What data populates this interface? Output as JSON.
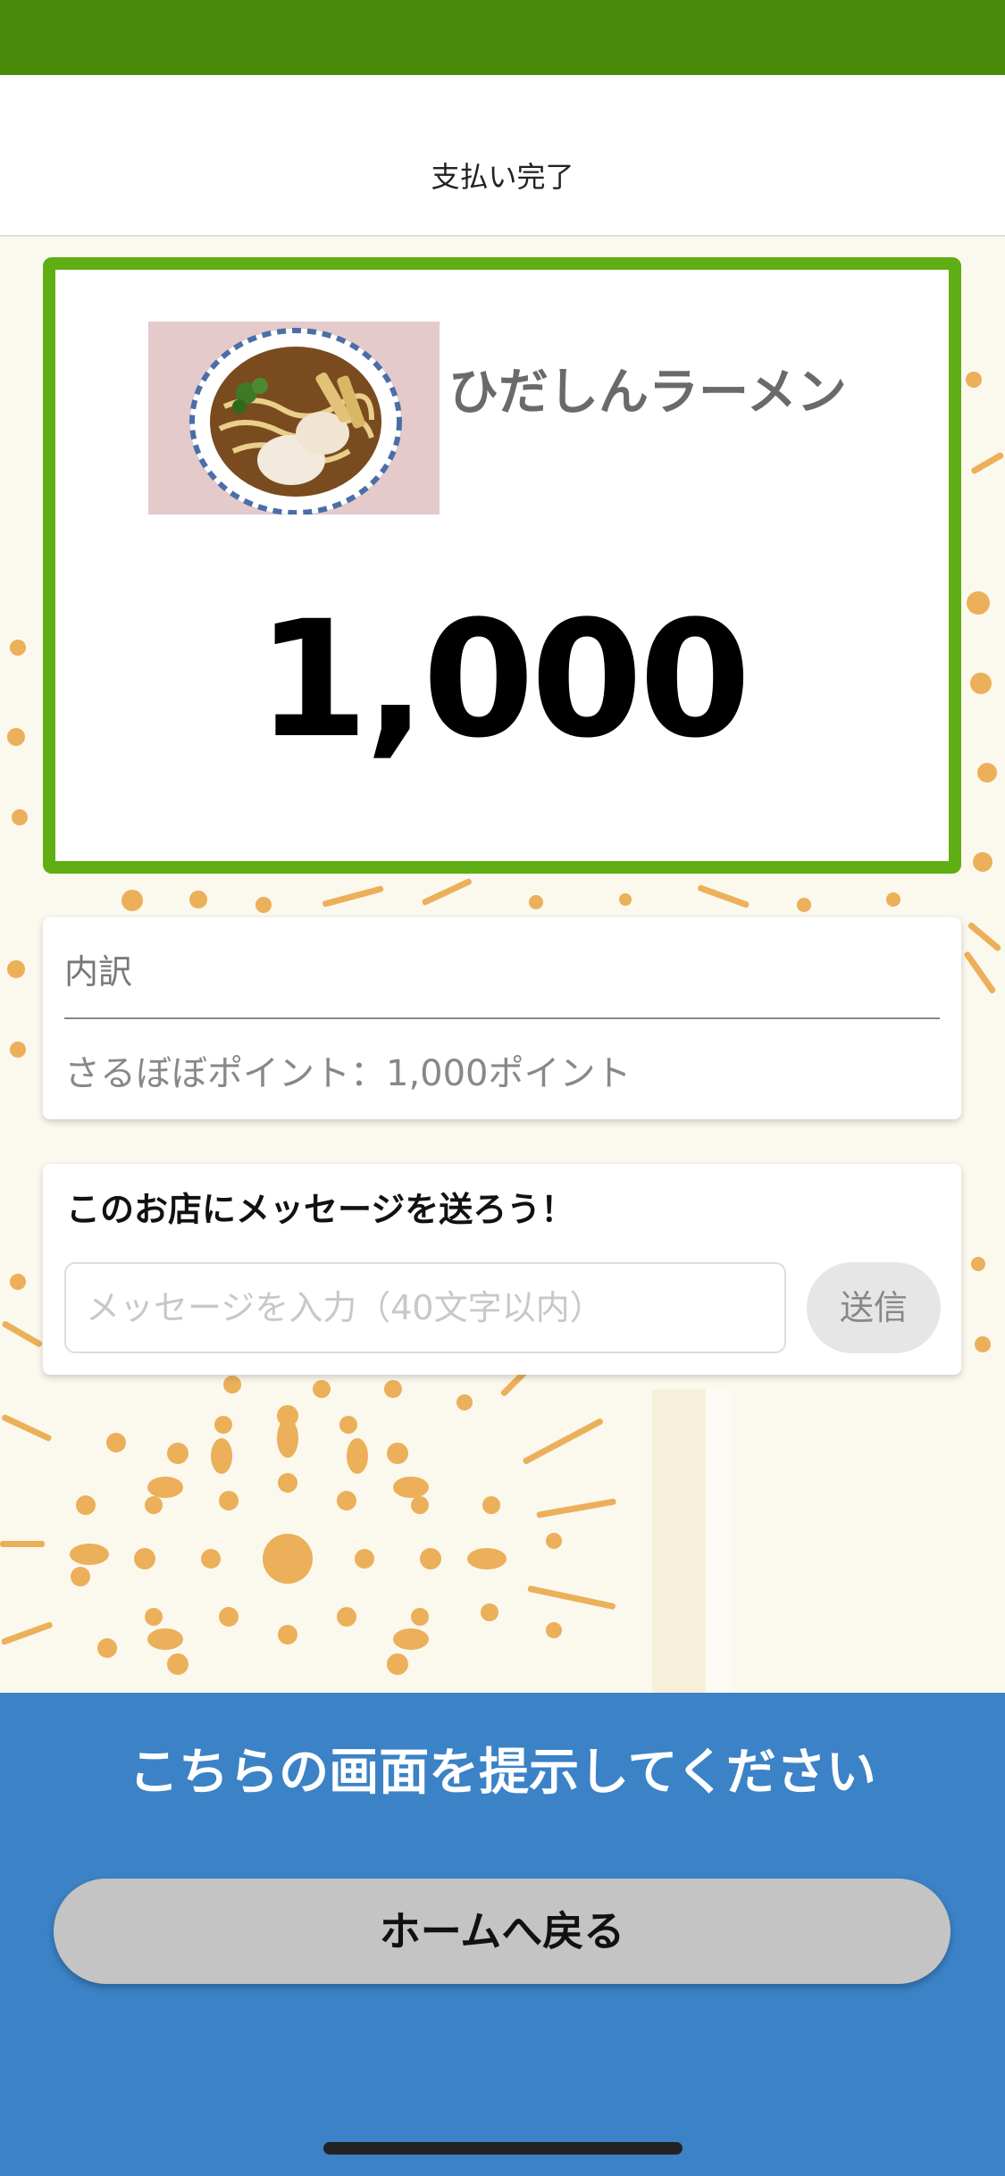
{
  "screen": {
    "title": "支払い完了"
  },
  "payment": {
    "shop_name": "ひだしんラーメン",
    "amount": "1,000",
    "image_icon": "ramen-bowl-photo"
  },
  "breakdown": {
    "title": "内訳",
    "items": [
      {
        "text": "さるぼぼポイント：1,000ポイント"
      }
    ]
  },
  "message": {
    "heading": "このお店にメッセージを送ろう！",
    "placeholder": "メッセージを入力（40文字以内）",
    "value": "",
    "send_label": "送信"
  },
  "footer": {
    "present_text": "こちらの画面を提示してください",
    "home_label": "ホームへ戻る"
  },
  "colors": {
    "status_bar": "#4a8a0a",
    "card_border": "#5fae13",
    "footer": "#3b82c6",
    "background": "#fbf8ee",
    "decoration": "#e8a33e"
  }
}
